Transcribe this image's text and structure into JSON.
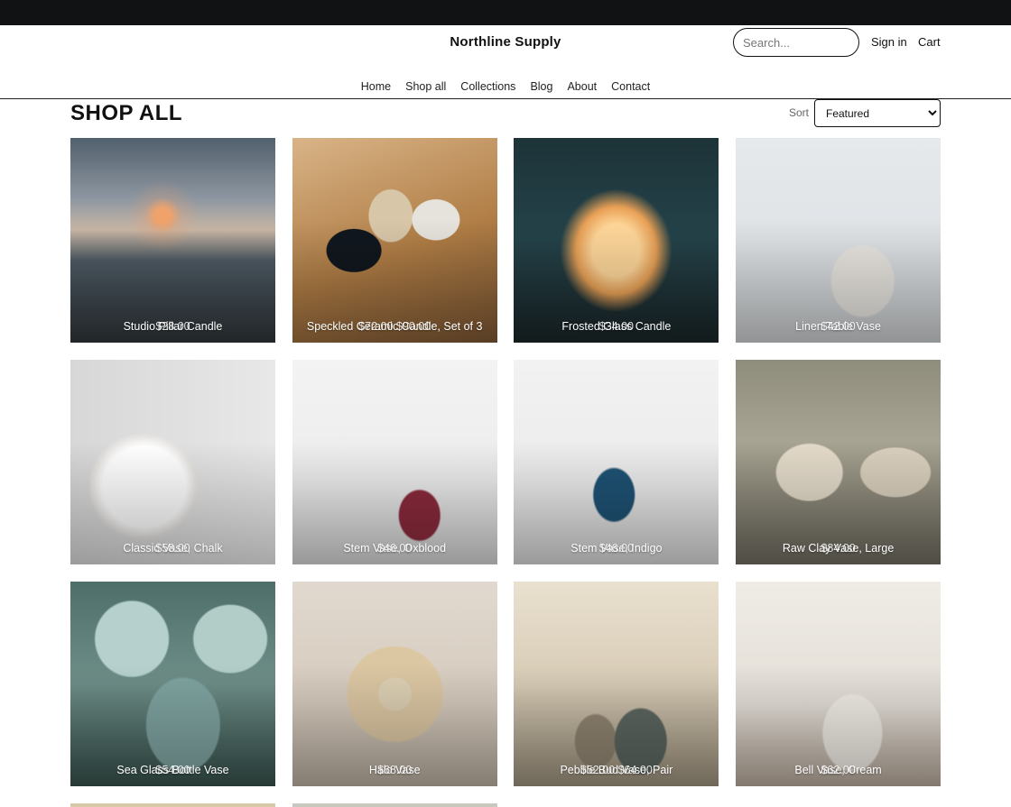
{
  "header": {
    "brand": "Northline Supply",
    "search_placeholder": "Search...",
    "signin_label": "Sign in",
    "cart_label": "Cart"
  },
  "nav": {
    "items": [
      {
        "label": "Home"
      },
      {
        "label": "Shop all"
      },
      {
        "label": "Collections"
      },
      {
        "label": "Blog"
      },
      {
        "label": "About"
      },
      {
        "label": "Contact"
      }
    ]
  },
  "page": {
    "title": "SHOP ALL",
    "sort_label": "Sort",
    "sort_value": "Featured"
  },
  "products": [
    {
      "title": "Studio Pillar Candle",
      "price": "$28.00"
    },
    {
      "title": "Speckled Ceramic Candle, Set of 3",
      "price": "$72.00 $90.00"
    },
    {
      "title": "Frosted Glass Candle",
      "price": "$34.00"
    },
    {
      "title": "Linen Table Vase",
      "price": "$42.00"
    },
    {
      "title": "Classic Vase, Chalk",
      "price": "$58.00"
    },
    {
      "title": "Stem Vase, Oxblood",
      "price": "$46.00"
    },
    {
      "title": "Stem Vase, Indigo",
      "price": "$46.00"
    },
    {
      "title": "Raw Clay Vase, Large",
      "price": "$84.00"
    },
    {
      "title": "Sea Glass Bottle Vase",
      "price": "$54.00"
    },
    {
      "title": "Halo Vase",
      "price": "$68.00"
    },
    {
      "title": "Pebble Bud Vase, Pair",
      "price": "$52.00 $64.00"
    },
    {
      "title": "Bell Vase, Cream",
      "price": "$62.00"
    }
  ]
}
